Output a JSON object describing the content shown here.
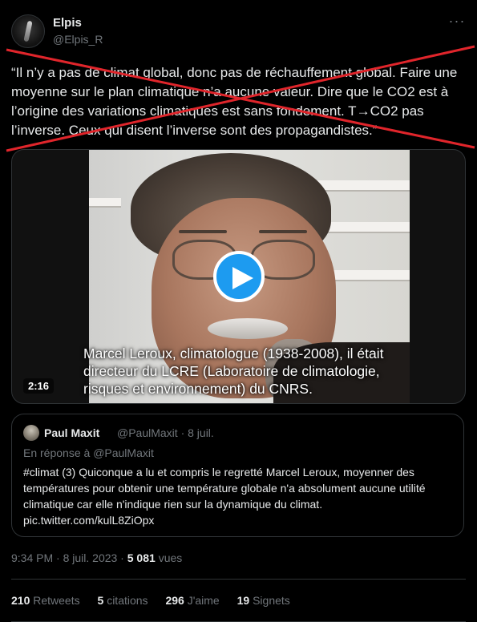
{
  "author": {
    "name": "Elpis",
    "handle": "@Elpis_R",
    "avatar_icon": "avatar-photo",
    "more_icon": "···"
  },
  "tweet": {
    "text": "“Il n’y a pas de climat global, donc pas de réchauffement global. Faire une moyenne sur le plan climatique n’a aucune valeur. Dire que le CO2 est à l’origine des variations climatiques est sans fondement. T→CO2 pas l’inverse. Ceux qui disent l’inverse sont des propagandistes.”",
    "strike_color": "#e0252b"
  },
  "media": {
    "caption": "Marcel Leroux, climatologue (1938-2008), il était directeur du LCRE (Laboratoire de climatologie, risques et environnement) du CNRS.",
    "duration": "2:16",
    "play_icon": "play-icon",
    "play_color": "#1d9bf0"
  },
  "quoted": {
    "name": "Paul Maxit",
    "handle_date": "@PaulMaxit · 8 juil.",
    "reply_prefix": "En réponse à",
    "reply_to": "@PaulMaxit",
    "text": "#climat (3) Quiconque a lu et compris le regretté Marcel Leroux, moyenner des températures pour obtenir une température globale n'a absolument aucune utilité climatique car elle n'indique rien sur la dynamique du climat. pic.twitter.com/kulL8ZiOpx"
  },
  "meta": {
    "time_date": "9:34 PM · 8 juil. 2023 · ",
    "views_count": "5 081",
    "views_label": "vues"
  },
  "stats": [
    {
      "count": "210",
      "label": "Retweets"
    },
    {
      "count": "5",
      "label": "citations"
    },
    {
      "count": "296",
      "label": "J'aime"
    },
    {
      "count": "19",
      "label": "Signets"
    }
  ],
  "colors": {
    "background": "#000000",
    "text": "#e7e9ea",
    "secondary": "#71767b",
    "border": "#2f3336"
  }
}
